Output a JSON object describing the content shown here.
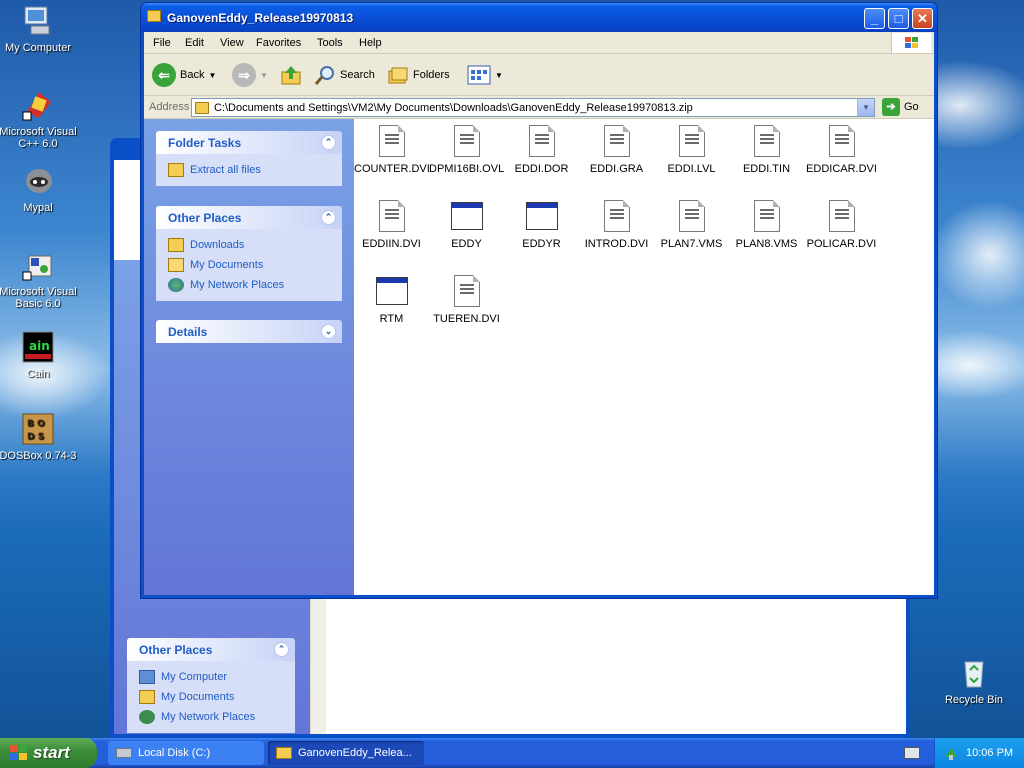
{
  "desktop": {
    "icons": [
      {
        "label": "My Computer",
        "icon": "computer-icon"
      },
      {
        "label": "Microsoft Visual C++ 6.0",
        "icon": "visual-cpp-icon"
      },
      {
        "label": "Mypal",
        "icon": "mypal-icon"
      },
      {
        "label": "Microsoft Visual Basic 6.0",
        "icon": "visual-basic-icon"
      },
      {
        "label": "Cain",
        "icon": "cain-icon"
      },
      {
        "label": "DOSBox 0.74-3",
        "icon": "dosbox-icon"
      },
      {
        "label": "Recycle Bin",
        "icon": "recycle-bin-icon"
      }
    ]
  },
  "background_window": {
    "other_places_title": "Other Places",
    "links": [
      "My Computer",
      "My Documents",
      "My Network Places"
    ]
  },
  "window": {
    "title": "GanovenEddy_Release19970813",
    "menu": [
      "File",
      "Edit",
      "View",
      "Favorites",
      "Tools",
      "Help"
    ],
    "toolbar": {
      "back": "Back",
      "search": "Search",
      "folders": "Folders"
    },
    "address": {
      "label": "Address",
      "value": "C:\\Documents and Settings\\VM2\\My Documents\\Downloads\\GanovenEddy_Release19970813.zip",
      "go": "Go"
    },
    "taskpane": {
      "folder_tasks": {
        "title": "Folder Tasks",
        "links": [
          "Extract all files"
        ]
      },
      "other_places": {
        "title": "Other Places",
        "links": [
          "Downloads",
          "My Documents",
          "My Network Places"
        ]
      },
      "details": {
        "title": "Details"
      }
    },
    "files": [
      {
        "name": "COUNTER.DVI",
        "kind": "document"
      },
      {
        "name": "DPMI16BI.OVL",
        "kind": "document"
      },
      {
        "name": "EDDI.DOR",
        "kind": "document"
      },
      {
        "name": "EDDI.GRA",
        "kind": "document"
      },
      {
        "name": "EDDI.LVL",
        "kind": "document"
      },
      {
        "name": "EDDI.TIN",
        "kind": "document"
      },
      {
        "name": "EDDICAR.DVI",
        "kind": "document"
      },
      {
        "name": "EDDIIN.DVI",
        "kind": "document"
      },
      {
        "name": "EDDY",
        "kind": "application"
      },
      {
        "name": "EDDYR",
        "kind": "application"
      },
      {
        "name": "INTROD.DVI",
        "kind": "document"
      },
      {
        "name": "PLAN7.VMS",
        "kind": "document"
      },
      {
        "name": "PLAN8.VMS",
        "kind": "document"
      },
      {
        "name": "POLICAR.DVI",
        "kind": "document"
      },
      {
        "name": "RTM",
        "kind": "application"
      },
      {
        "name": "TUEREN.DVI",
        "kind": "document"
      }
    ]
  },
  "taskbar": {
    "start": "start",
    "tasks": [
      "Local Disk (C:)",
      "GanovenEddy_Relea..."
    ],
    "clock": "10:06 PM"
  },
  "colors": {
    "xp_blue": "#0a4fc7",
    "taskpane": "#7aa1e6",
    "start_green": "#3c8f3a",
    "link": "#215dc6"
  }
}
